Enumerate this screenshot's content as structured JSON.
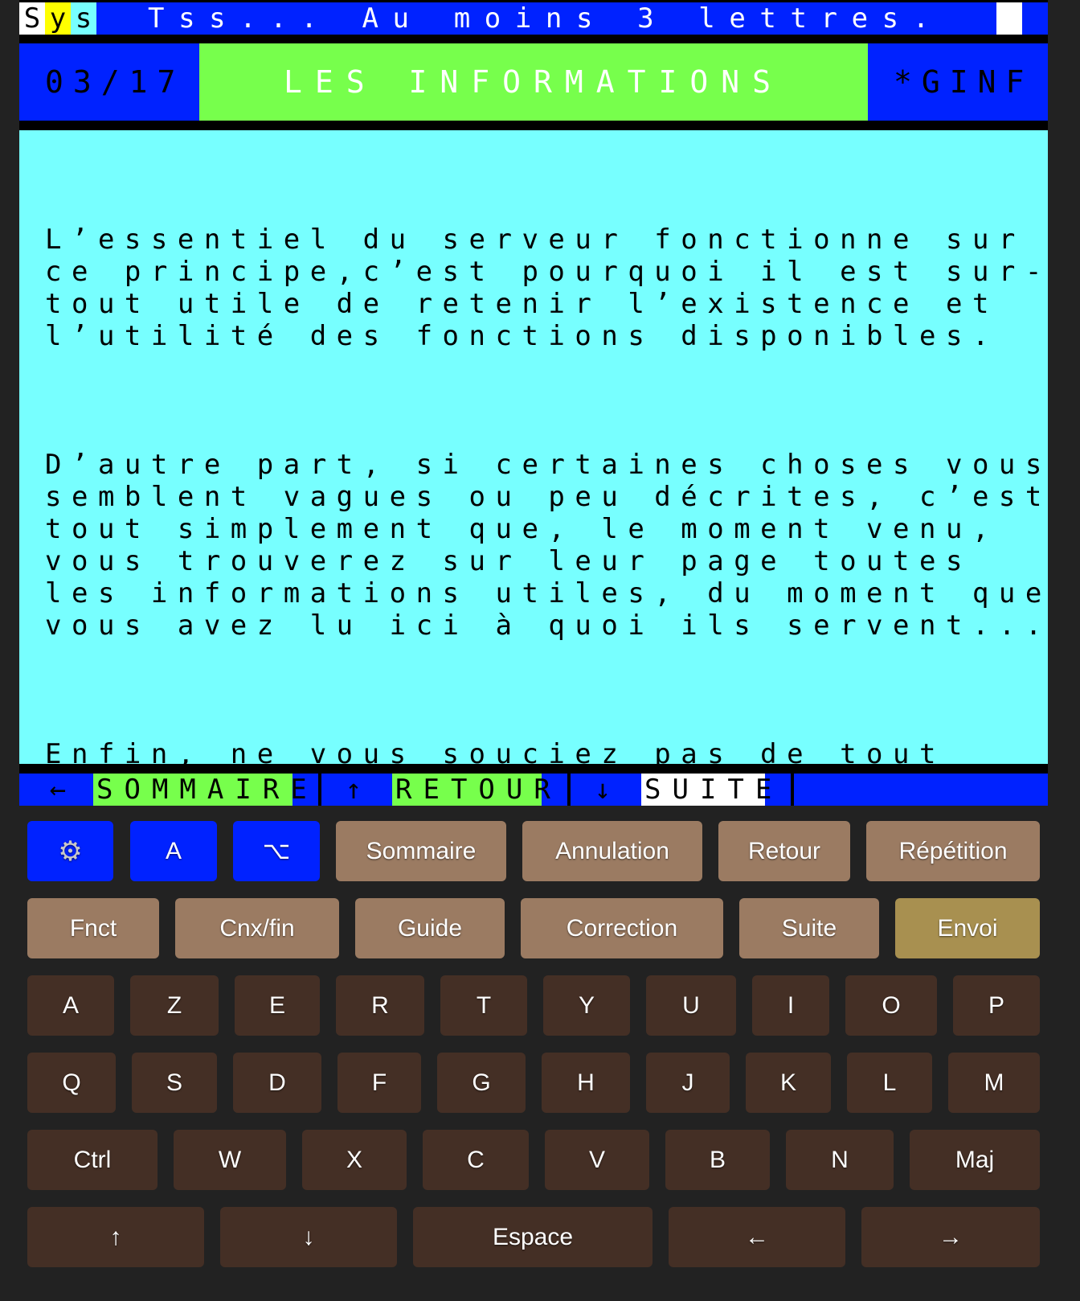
{
  "status_bar": {
    "logo": [
      "S",
      "y",
      "s"
    ],
    "message": "Tss... Au moins 3 lettres."
  },
  "header": {
    "page_counter": "03/17",
    "title": "LES INFORMATIONS",
    "code": "*GINF"
  },
  "content": {
    "paragraphs": [
      "L’essentiel du serveur fonctionne sur\nce principe,c’est pourquoi il est sur-\ntout utile de retenir l’existence et\nl’utilité des fonctions disponibles.",
      "D’autre part, si certaines choses vous\nsemblent vagues ou peu décrites, c’est\ntout simplement que, le moment venu,\nvous trouverez sur leur page toutes\nles informations utiles, du moment que\nvous avez lu ici à quoi ils servent...",
      "Enfin, ne vous souciez pas de tout\ncomprendre ou retenir en première\nlecture : c’est après quelques temps\nd’utilisation que, avec le contexte,\nbeaucoup de choses deviennent évi-\ndentes en relisant les guides..."
    ]
  },
  "nav_bar": {
    "items": [
      {
        "arrow": "←",
        "label": "SOMMAIRE"
      },
      {
        "arrow": "↑",
        "label": "RETOUR"
      },
      {
        "arrow": "↓",
        "label": "SUITE"
      }
    ]
  },
  "keyboard": {
    "row1": {
      "settings_icon": "⚙",
      "alpha": "A",
      "option_icon": "⌥",
      "sommaire": "Sommaire",
      "annulation": "Annulation",
      "retour": "Retour",
      "repetition": "Répétition"
    },
    "row2": {
      "fnct": "Fnct",
      "cnx": "Cnx/fin",
      "guide": "Guide",
      "correction": "Correction",
      "suite": "Suite",
      "envoi": "Envoi"
    },
    "row3": [
      "A",
      "Z",
      "E",
      "R",
      "T",
      "Y",
      "U",
      "I",
      "O",
      "P"
    ],
    "row4": [
      "Q",
      "S",
      "D",
      "F",
      "G",
      "H",
      "J",
      "K",
      "L",
      "M"
    ],
    "row5": {
      "ctrl": "Ctrl",
      "letters": [
        "W",
        "X",
        "C",
        "V",
        "B",
        "N"
      ],
      "maj": "Maj"
    },
    "row6": {
      "up": "↑",
      "down": "↓",
      "space": "Espace",
      "left": "←",
      "right": "→"
    }
  },
  "colors": {
    "blue": "#0022ff",
    "green": "#77ff4c",
    "cyan": "#77ffff",
    "yellow": "#ffff00",
    "key_function": "#9b7b62",
    "key_send": "#a89050",
    "key_letter": "#442f25"
  }
}
